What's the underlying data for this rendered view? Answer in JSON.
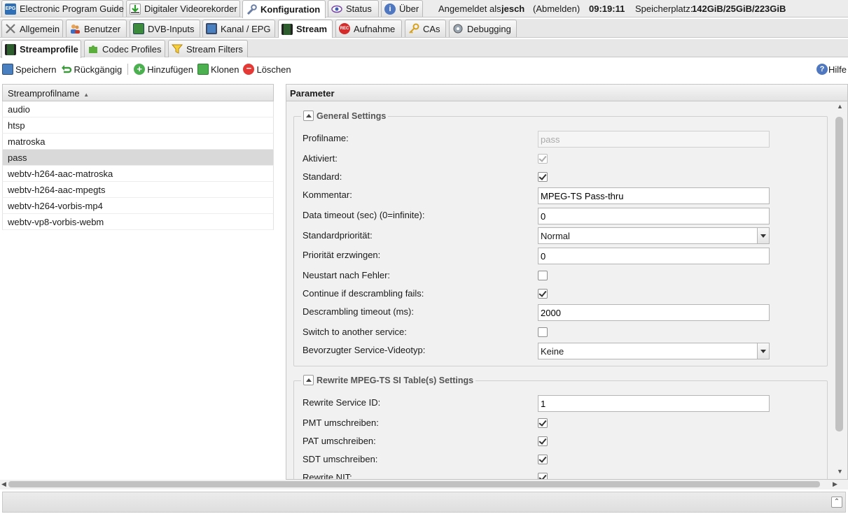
{
  "main_tabs": [
    {
      "label": "Electronic Program Guide",
      "icon": "epg-icon"
    },
    {
      "label": "Digitaler Videorekorder",
      "icon": "download-icon"
    },
    {
      "label": "Konfiguration",
      "icon": "wrench-icon",
      "active": true
    },
    {
      "label": "Status",
      "icon": "eye-icon"
    },
    {
      "label": "Über",
      "icon": "info-icon"
    }
  ],
  "status": {
    "logged_in_prefix": "Angemeldet als",
    "user": "jesch",
    "logout": "(Abmelden)",
    "time": "09:19:11",
    "storage_label": "Speicherplatz:",
    "storage_value": "142GiB/25GiB/223GiB"
  },
  "config_tabs": [
    {
      "label": "Allgemein",
      "icon": "tools-icon"
    },
    {
      "label": "Benutzer",
      "icon": "users-icon"
    },
    {
      "label": "DVB-Inputs",
      "icon": "card-icon"
    },
    {
      "label": "Kanal / EPG",
      "icon": "tv-icon"
    },
    {
      "label": "Stream",
      "icon": "film-icon",
      "active": true
    },
    {
      "label": "Aufnahme",
      "icon": "rec-icon"
    },
    {
      "label": "CAs",
      "icon": "key-icon"
    },
    {
      "label": "Debugging",
      "icon": "bug-icon"
    }
  ],
  "stream_tabs": [
    {
      "label": "Streamprofile",
      "icon": "film-icon",
      "active": true
    },
    {
      "label": "Codec Profiles",
      "icon": "puzzle-icon"
    },
    {
      "label": "Stream Filters",
      "icon": "filter-icon"
    }
  ],
  "toolbar": {
    "save": "Speichern",
    "undo": "Rückgängig",
    "add": "Hinzufügen",
    "clone": "Klonen",
    "delete": "Löschen",
    "help": "Hilfe"
  },
  "list": {
    "header": "Streamprofilname",
    "items": [
      "audio",
      "htsp",
      "matroska",
      "pass",
      "webtv-h264-aac-matroska",
      "webtv-h264-aac-mpegts",
      "webtv-h264-vorbis-mp4",
      "webtv-vp8-vorbis-webm"
    ],
    "selected": "pass"
  },
  "params": {
    "header": "Parameter",
    "general": {
      "title": "General Settings",
      "profile_name_label": "Profilname:",
      "profile_name_value": "pass",
      "enabled_label": "Aktiviert:",
      "default_label": "Standard:",
      "comment_label": "Kommentar:",
      "comment_value": "MPEG-TS Pass-thru",
      "timeout_label": "Data timeout (sec) (0=infinite):",
      "timeout_value": "0",
      "priority_label": "Standardpriorität:",
      "priority_value": "Normal",
      "force_priority_label": "Priorität erzwingen:",
      "force_priority_value": "0",
      "restart_label": "Neustart nach Fehler:",
      "continue_label": "Continue if descrambling fails:",
      "descr_timeout_label": "Descrambling timeout (ms):",
      "descr_timeout_value": "2000",
      "switch_label": "Switch to another service:",
      "video_type_label": "Bevorzugter Service-Videotyp:",
      "video_type_value": "Keine"
    },
    "rewrite": {
      "title": "Rewrite MPEG-TS SI Table(s) Settings",
      "sid_label": "Rewrite Service ID:",
      "sid_value": "1",
      "pmt_label": "PMT umschreiben:",
      "pat_label": "PAT umschreiben:",
      "sdt_label": "SDT umschreiben:",
      "nit_label": "Rewrite NIT:"
    },
    "checkboxes": {
      "enabled": true,
      "default": true,
      "restart": false,
      "continue": true,
      "switch": false,
      "pmt": true,
      "pat": true,
      "sdt": true,
      "nit": true
    }
  },
  "colors": {
    "selected_row": "#d9d9d9",
    "panel_bg": "#f1f1f1"
  }
}
